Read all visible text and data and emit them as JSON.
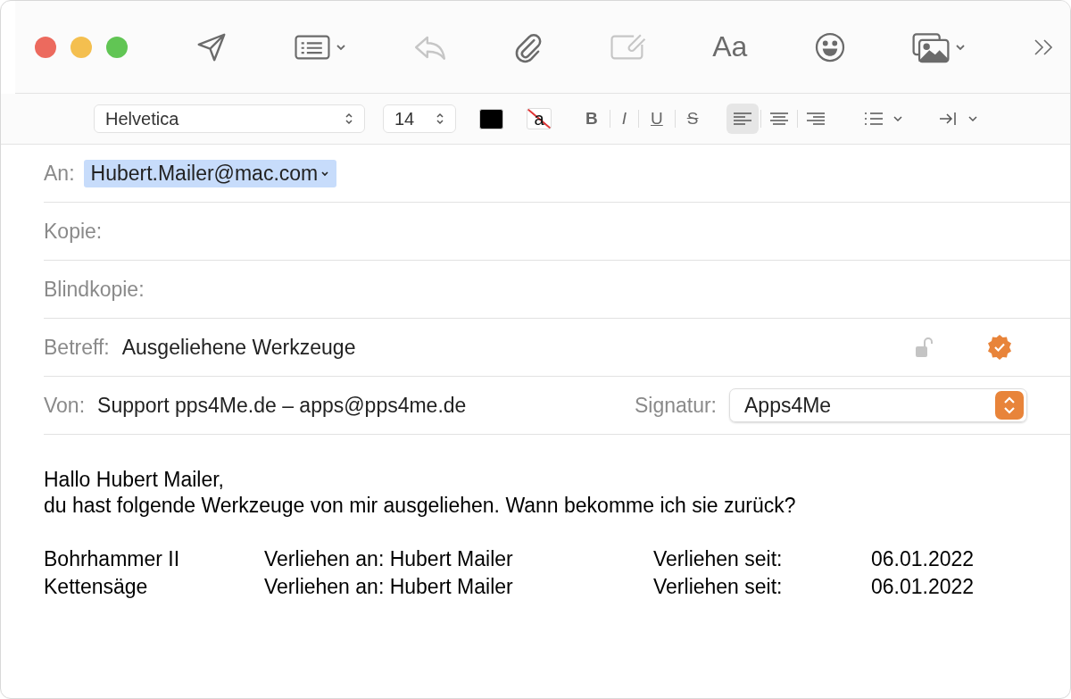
{
  "toolbar": {
    "buttons": [
      {
        "kind": "send",
        "disabled": false,
        "menu": false
      },
      {
        "kind": "header-fields",
        "disabled": false,
        "menu": true
      },
      {
        "kind": "reply",
        "disabled": true,
        "menu": false
      },
      {
        "kind": "attach",
        "disabled": false,
        "menu": false
      },
      {
        "kind": "markup",
        "disabled": true,
        "menu": false
      },
      {
        "kind": "format",
        "label": "Aa",
        "disabled": false,
        "menu": false
      },
      {
        "kind": "emoji",
        "disabled": false,
        "menu": false
      },
      {
        "kind": "photo",
        "disabled": false,
        "menu": true
      }
    ]
  },
  "format_bar": {
    "font": "Helvetica",
    "size": "14",
    "styles": [
      "B",
      "I",
      "U",
      "S"
    ],
    "highlight_label": "a",
    "alignments": [
      {
        "kind": "left",
        "selected": true
      },
      {
        "kind": "center",
        "selected": false
      },
      {
        "kind": "right",
        "selected": false
      }
    ]
  },
  "header": {
    "to": {
      "label": "An:",
      "recipients": [
        {
          "address": "Hubert.Mailer@mac.com",
          "selected": true
        }
      ]
    },
    "cc": {
      "label": "Kopie:"
    },
    "bcc": {
      "label": "Blindkopie:"
    },
    "subject": {
      "label": "Betreff:",
      "value": "Ausgeliehene Werkzeuge"
    },
    "from": {
      "label": "Von:",
      "value": "Support pps4Me.de – apps@pps4me.de"
    },
    "signature": {
      "label": "Signatur:",
      "value": "Apps4Me"
    }
  },
  "body": {
    "lines": [
      "Hallo Hubert Mailer,",
      "du hast folgende Werkzeuge von mir ausgeliehen. Wann bekomme ich sie zurück?"
    ],
    "rows": [
      {
        "tool": "Bohrhammer II",
        "lent_to": "Verliehen an: Hubert Mailer",
        "since_label": "Verliehen seit:",
        "date": "06.01.2022"
      },
      {
        "tool": "Kettensäge",
        "lent_to": "Verliehen an: Hubert Mailer",
        "since_label": "Verliehen seit:",
        "date": "06.01.2022"
      }
    ]
  }
}
